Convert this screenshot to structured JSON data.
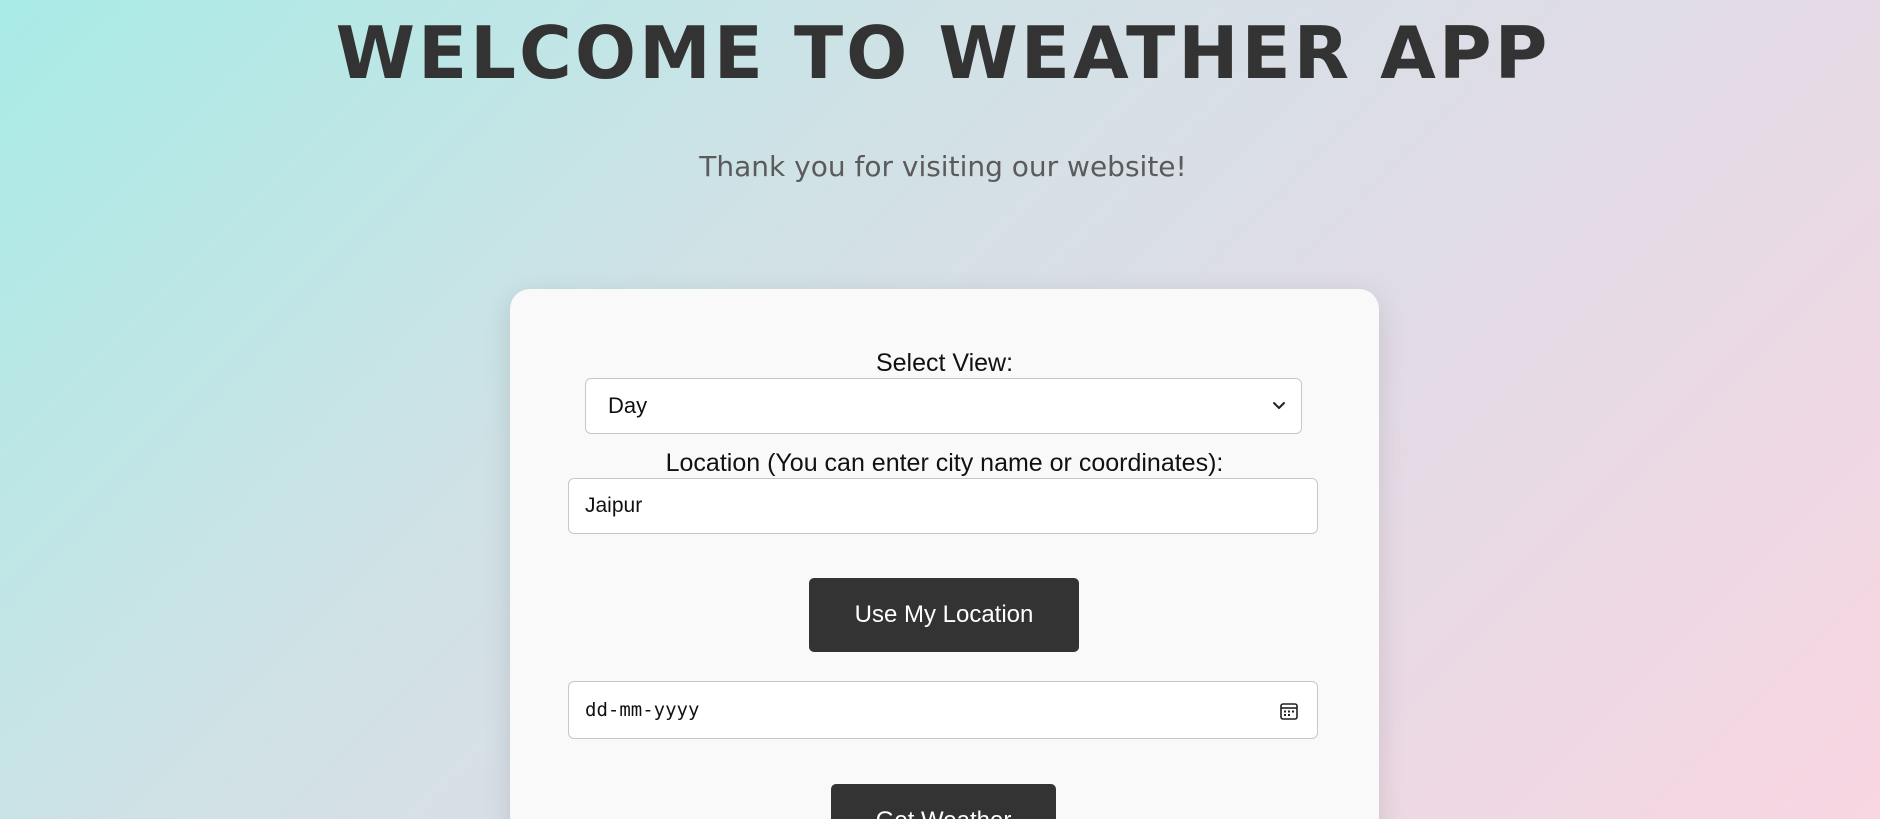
{
  "page": {
    "title": "WELCOME TO WEATHER APP",
    "subtitle": "Thank you for visiting our website!"
  },
  "form": {
    "view_label": "Select View:",
    "view_selected": "Day",
    "location_label": "Location (You can enter city name or coordinates):",
    "location_value": "Jaipur",
    "use_location_label": "Use My Location",
    "date_placeholder": "dd-mm-yyyy",
    "get_weather_label": "Get Weather"
  },
  "icons": {
    "select_arrow": "chevron-down-icon",
    "date_picker": "calendar-icon"
  },
  "colors": {
    "button_bg": "#333333",
    "title": "#333333",
    "card_bg": "#f9f9fa"
  }
}
